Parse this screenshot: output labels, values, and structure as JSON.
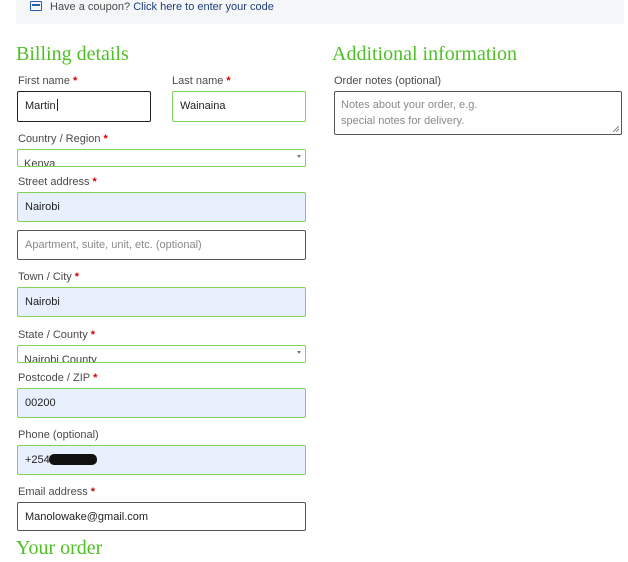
{
  "coupon": {
    "icon": "coupon-icon",
    "prompt": "Have a coupon?",
    "link": "Click here to enter your code"
  },
  "billing": {
    "heading": "Billing details",
    "first_name": {
      "label": "First name",
      "value": "Martin"
    },
    "last_name": {
      "label": "Last name",
      "value": "Wainaina"
    },
    "country": {
      "label": "Country / Region",
      "value": "Kenya"
    },
    "street": {
      "label": "Street address",
      "value": "Nairobi",
      "placeholder2": "Apartment, suite, unit, etc. (optional)"
    },
    "town": {
      "label": "Town / City",
      "value": "Nairobi"
    },
    "state": {
      "label": "State / County",
      "value": "Nairobi County"
    },
    "postcode": {
      "label": "Postcode / ZIP",
      "value": "00200"
    },
    "phone": {
      "label": "Phone (optional)",
      "value_visible": "+254"
    },
    "email": {
      "label": "Email address",
      "value": "Manolowake@gmail.com"
    },
    "required_marker": "*"
  },
  "additional": {
    "heading": "Additional information",
    "notes_label": "Order notes (optional)",
    "notes_placeholder_line1": "Notes about your order, e.g.",
    "notes_placeholder_line2": "special notes for delivery."
  },
  "order": {
    "heading": "Your order"
  },
  "colors": {
    "heading_green": "#4fbf26",
    "field_border_green": "#7fd35a",
    "autofill_blue": "#e8f0fe",
    "required_red": "#d00000",
    "link_blue": "#1f3f7a"
  }
}
